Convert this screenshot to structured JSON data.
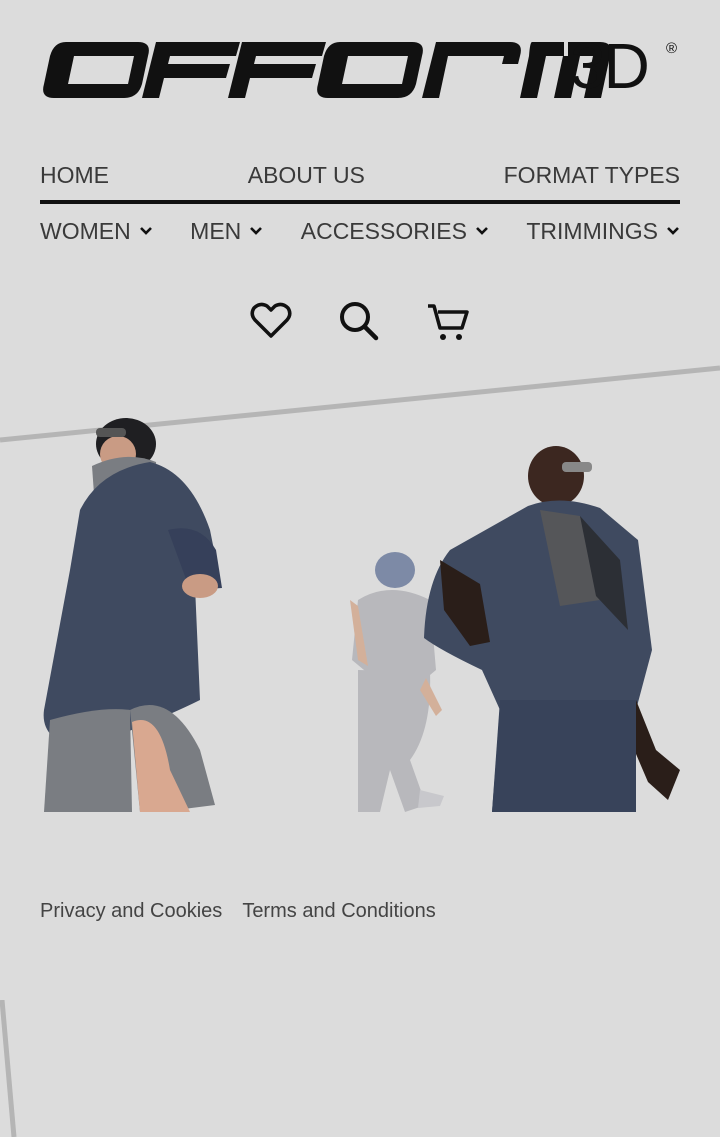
{
  "brand": {
    "logo_main": "OFFORM",
    "logo_suffix": "3D",
    "logo_reg": "®"
  },
  "nav_top": [
    {
      "label": "HOME"
    },
    {
      "label": "ABOUT US"
    },
    {
      "label": "FORMAT TYPES"
    }
  ],
  "nav_categories": [
    {
      "label": "WOMEN",
      "icon": "chevron-down-icon"
    },
    {
      "label": "MEN",
      "icon": "chevron-down-icon"
    },
    {
      "label": "ACCESSORIES",
      "icon": "chevron-down-icon"
    },
    {
      "label": "TRIMMINGS",
      "icon": "chevron-down-icon"
    }
  ],
  "action_icons": [
    "heart-icon",
    "search-icon",
    "cart-icon"
  ],
  "footer": {
    "privacy": "Privacy and Cookies",
    "terms": "Terms and Conditions"
  },
  "colors": {
    "background": "#dcdcdc",
    "text": "#3a3a3a",
    "accent": "#111111",
    "coat_navy": "#3f4a60",
    "suit_grey": "#b8b8bc"
  }
}
